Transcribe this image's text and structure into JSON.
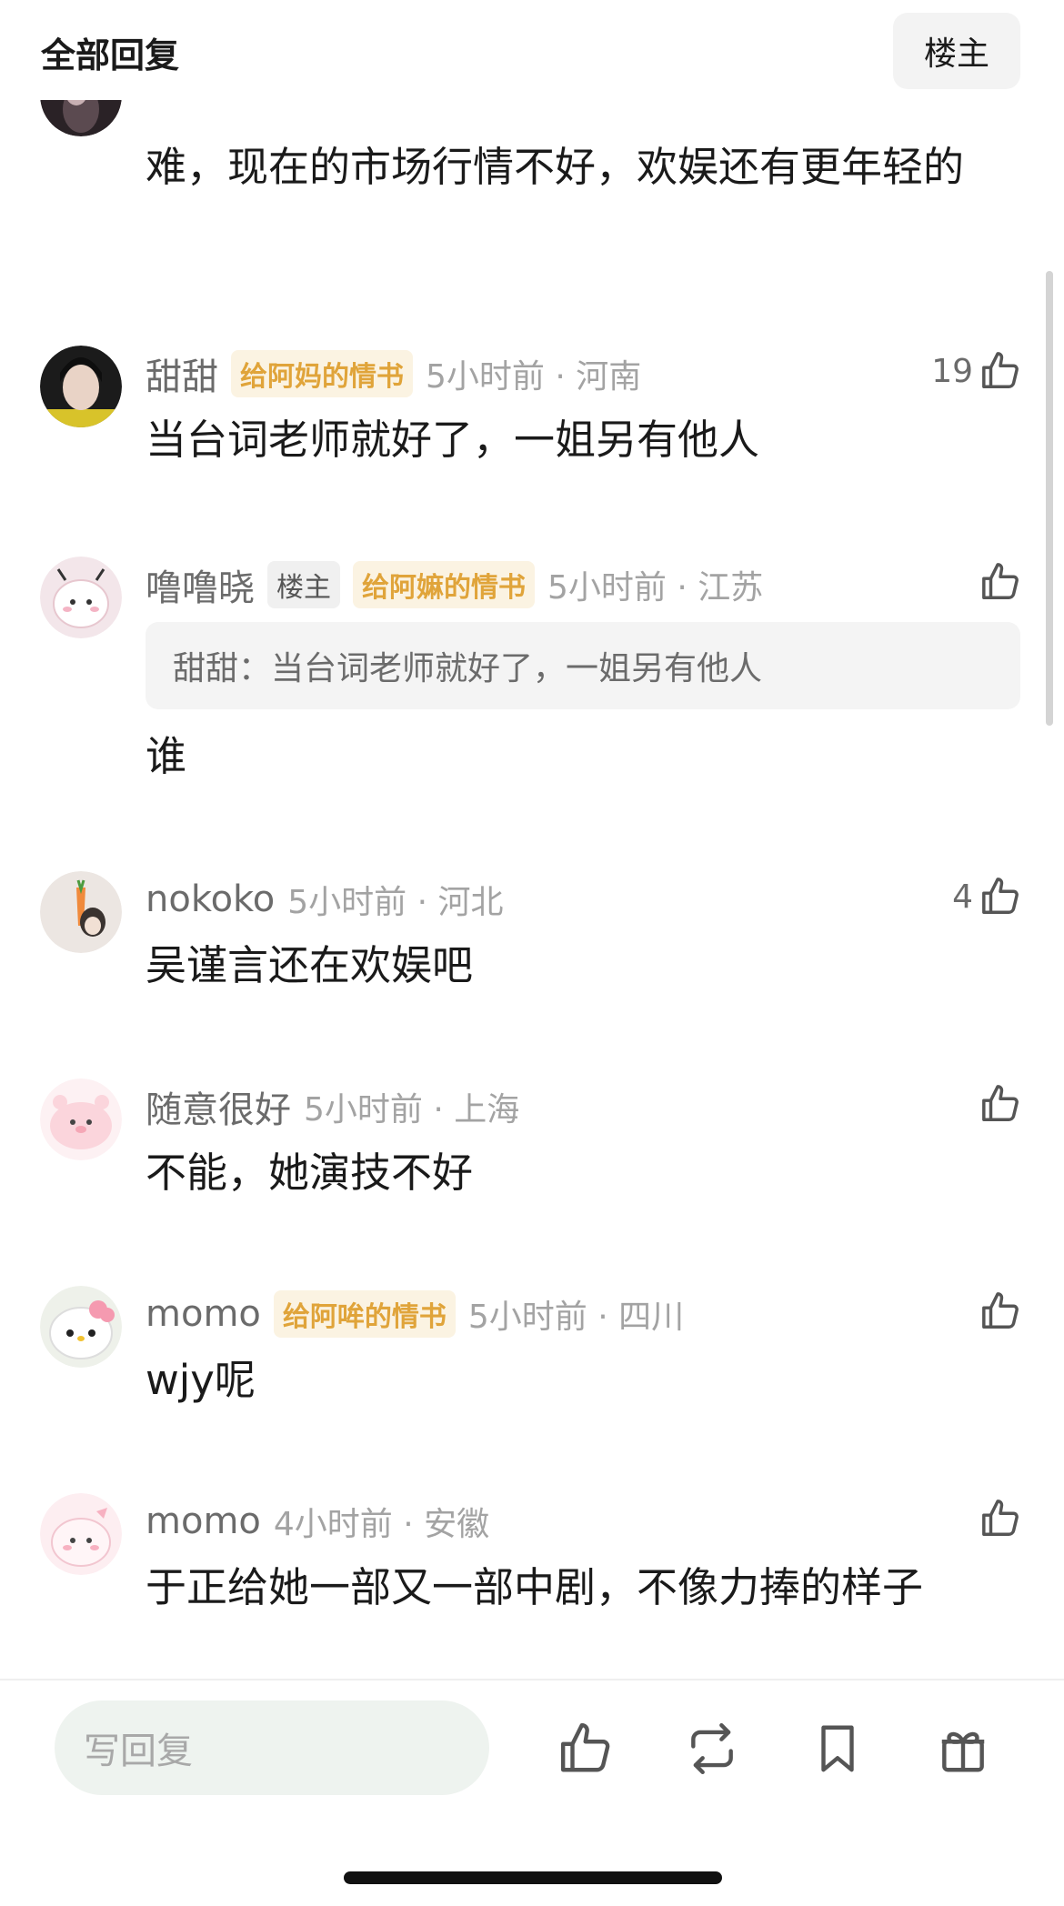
{
  "header": {
    "title": "全部回复",
    "owner_button": "楼主"
  },
  "partial_comment": {
    "text": "难，现在的市场行情不好，欢娱还有更年轻的"
  },
  "comments": [
    {
      "username": "甜甜",
      "badge": "给阿妈的情书",
      "time": "5小时前 · 河南",
      "likes": "19",
      "text": "当台词老师就好了，一姐另有他人"
    },
    {
      "username": "噜噜晓",
      "owner_badge": "楼主",
      "badge": "给阿嫲的情书",
      "time": "5小时前 · 江苏",
      "likes": "",
      "quote": "甜甜：当台词老师就好了，一姐另有他人",
      "text": "谁"
    },
    {
      "username": "nokoko",
      "time": "5小时前 · 河北",
      "likes": "4",
      "text": "吴谨言还在欢娱吧"
    },
    {
      "username": "随意很好",
      "time": "5小时前 · 上海",
      "likes": "",
      "text": "不能，她演技不好"
    },
    {
      "username": "momo",
      "badge": "给阿哞的情书",
      "time": "5小时前 · 四川",
      "likes": "",
      "text": "wjy呢"
    },
    {
      "username": "momo",
      "time": "4小时前 · 安徽",
      "likes": "",
      "text": "于正给她一部又一部中剧，不像力捧的样子"
    }
  ],
  "bottom_bar": {
    "reply_placeholder": "写回复",
    "icons": [
      "like-icon",
      "repost-icon",
      "bookmark-icon",
      "gift-icon"
    ]
  },
  "colors": {
    "badge_gold": "#e0a43a",
    "meta_gray": "#a3a3a3",
    "input_bg": "#eef3ef"
  }
}
